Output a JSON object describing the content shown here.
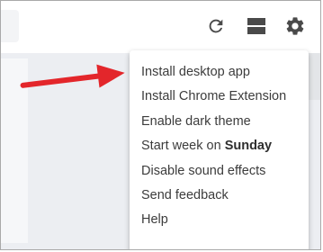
{
  "toolbar": {
    "icons": [
      "refresh-icon",
      "view-toggle-icon",
      "gear-icon"
    ]
  },
  "settings_menu": {
    "items": [
      {
        "label": "Install desktop app"
      },
      {
        "label": "Install Chrome Extension"
      },
      {
        "label": "Enable dark theme"
      },
      {
        "prefix": "Start week on ",
        "emphasis": "Sunday"
      },
      {
        "label": "Disable sound effects"
      },
      {
        "label": "Send feedback"
      },
      {
        "label": "Help"
      }
    ]
  },
  "annotation": {
    "icon": "red-arrow-icon",
    "color": "#e3262b"
  },
  "colors": {
    "icon": "#4a4a4a",
    "menu_text": "#3c3c3c"
  }
}
